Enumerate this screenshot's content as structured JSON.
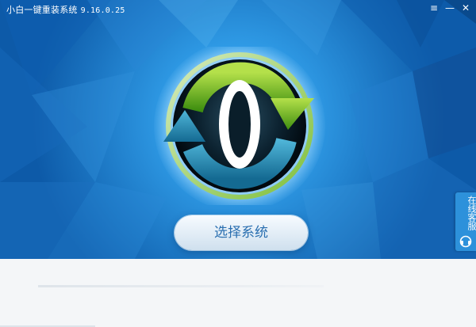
{
  "window": {
    "title": "小白一键重装系统",
    "version": "9.16.0.25",
    "menu_glyph": "≡",
    "minimize_glyph": "—",
    "close_glyph": "✕"
  },
  "main": {
    "select_button_label": "选择系统"
  },
  "side_tab": {
    "label": "在线客服"
  },
  "colors": {
    "hero_blue": "#1e7fd0",
    "green_arrow": "#7ab81e",
    "teal_arrow": "#2f8fb4",
    "button_text": "#2a6fb0"
  },
  "icons": [
    "menu-icon",
    "minimize-icon",
    "close-icon",
    "headset-icon",
    "logo-refresh-icon"
  ]
}
